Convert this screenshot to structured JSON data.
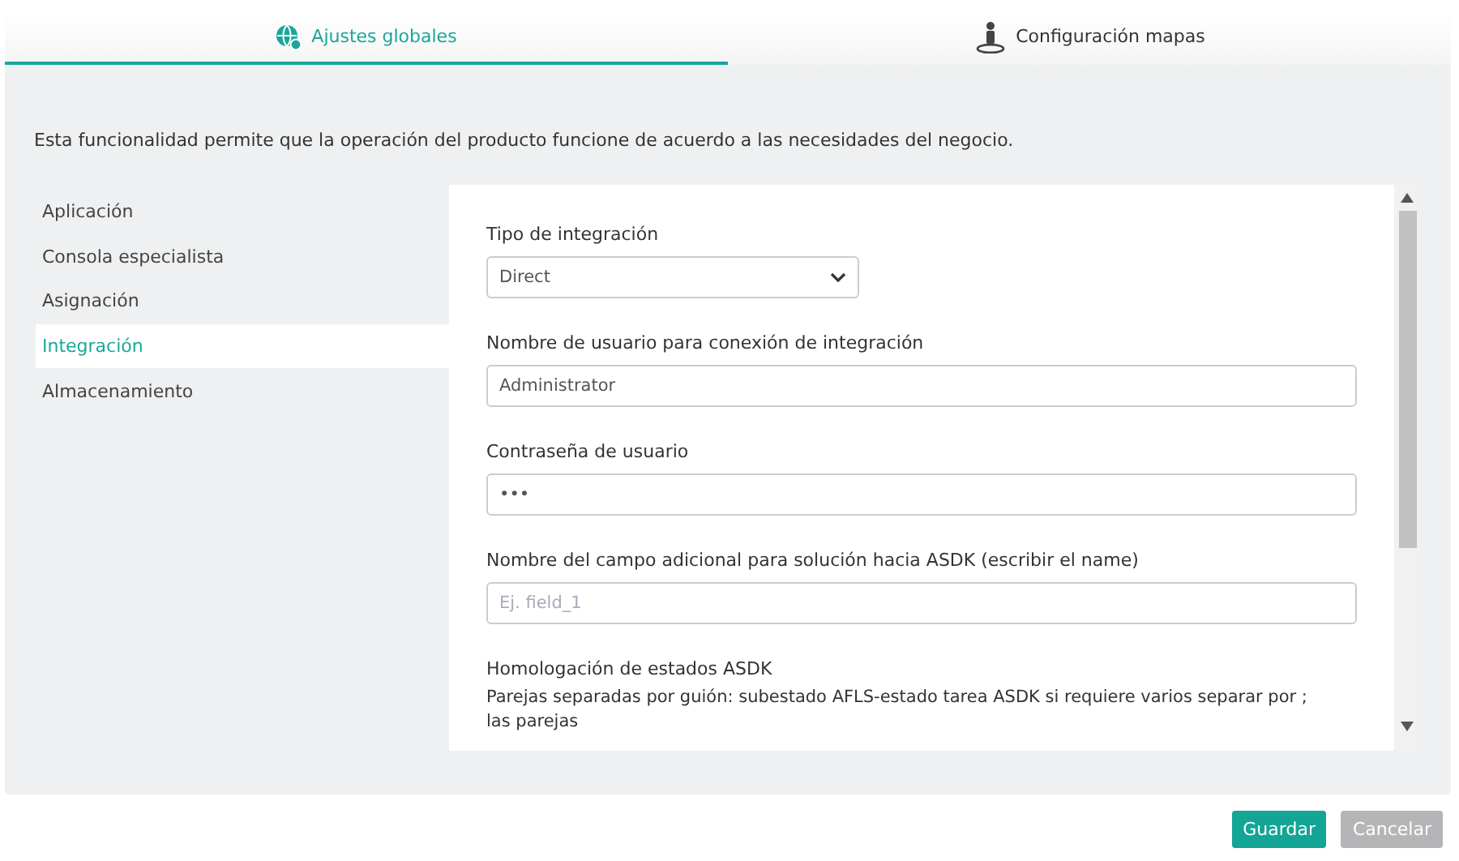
{
  "tabs": [
    {
      "label": "Ajustes globales",
      "selected": true
    },
    {
      "label": "Configuración mapas",
      "selected": false
    }
  ],
  "description": "Esta funcionalidad permite que la operación del producto funcione de acuerdo a las necesidades del negocio.",
  "sidebar": {
    "items": [
      {
        "label": "Aplicación",
        "selected": false
      },
      {
        "label": "Consola especialista",
        "selected": false
      },
      {
        "label": "Asignación",
        "selected": false
      },
      {
        "label": "Integración",
        "selected": true
      },
      {
        "label": "Almacenamiento",
        "selected": false
      }
    ]
  },
  "form": {
    "fields": [
      {
        "kind": "select",
        "label": "Tipo de integración",
        "value": "Direct"
      },
      {
        "kind": "text",
        "label": "Nombre de usuario para conexión de integración",
        "value": "Administrator"
      },
      {
        "kind": "password",
        "label": "Contraseña de usuario",
        "value": "•••"
      },
      {
        "kind": "text",
        "label": "Nombre del campo adicional para solución hacia ASDK (escribir el name)",
        "placeholder": "Ej. field_1"
      },
      {
        "kind": "note",
        "label": "Homologación de estados ASDK",
        "hint": "Parejas separadas por guión: subestado AFLS-estado tarea ASDK si requiere varios separar por ; las parejas"
      }
    ]
  },
  "buttons": [
    {
      "label": "Guardar",
      "kind": "primary"
    },
    {
      "label": "Cancelar",
      "kind": "secondary"
    }
  ]
}
